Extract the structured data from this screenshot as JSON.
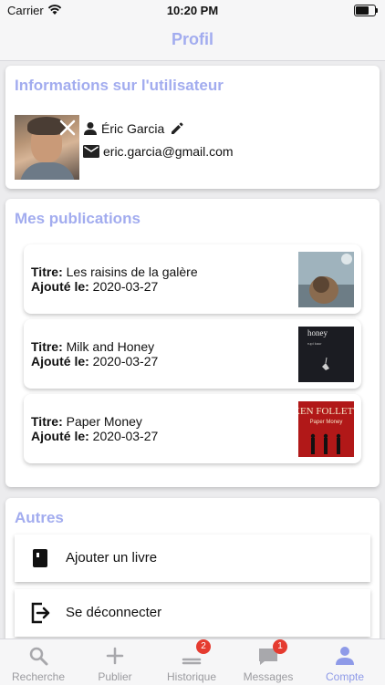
{
  "status_bar": {
    "carrier": "Carrier",
    "time": "10:20 PM"
  },
  "nav": {
    "title": "Profil"
  },
  "user_info": {
    "title": "Informations sur l'utilisateur",
    "name": "Éric Garcia",
    "email": "eric.garcia@gmail.com"
  },
  "publications": {
    "title": "Mes publications",
    "title_label": "Titre:",
    "added_label": "Ajouté le:",
    "items": [
      {
        "title": "Les raisins de la galère",
        "added": "2020-03-27"
      },
      {
        "title": "Milk and Honey",
        "added": "2020-03-27",
        "cover_text": "honey",
        "cover_author": "rupi kaur"
      },
      {
        "title": "Paper Money",
        "added": "2020-03-27",
        "cover_text": "KEN FOLLETT",
        "cover_sub": "Paper Money"
      }
    ]
  },
  "autres": {
    "title": "Autres",
    "items": [
      {
        "label": "Ajouter un livre",
        "icon": "book-icon"
      },
      {
        "label": "Se déconnecter",
        "icon": "logout-icon"
      }
    ]
  },
  "tabs": [
    {
      "label": "Recherche",
      "icon": "search-icon",
      "active": false
    },
    {
      "label": "Publier",
      "icon": "plus-icon",
      "active": false
    },
    {
      "label": "Historique",
      "icon": "history-icon",
      "active": false,
      "badge": "2"
    },
    {
      "label": "Messages",
      "icon": "message-icon",
      "active": false,
      "badge": "1"
    },
    {
      "label": "Compte",
      "icon": "account-icon",
      "active": true
    }
  ],
  "colors": {
    "accent": "#a2acef",
    "tab_active": "#8e9ae8",
    "badge": "#e53b30"
  }
}
